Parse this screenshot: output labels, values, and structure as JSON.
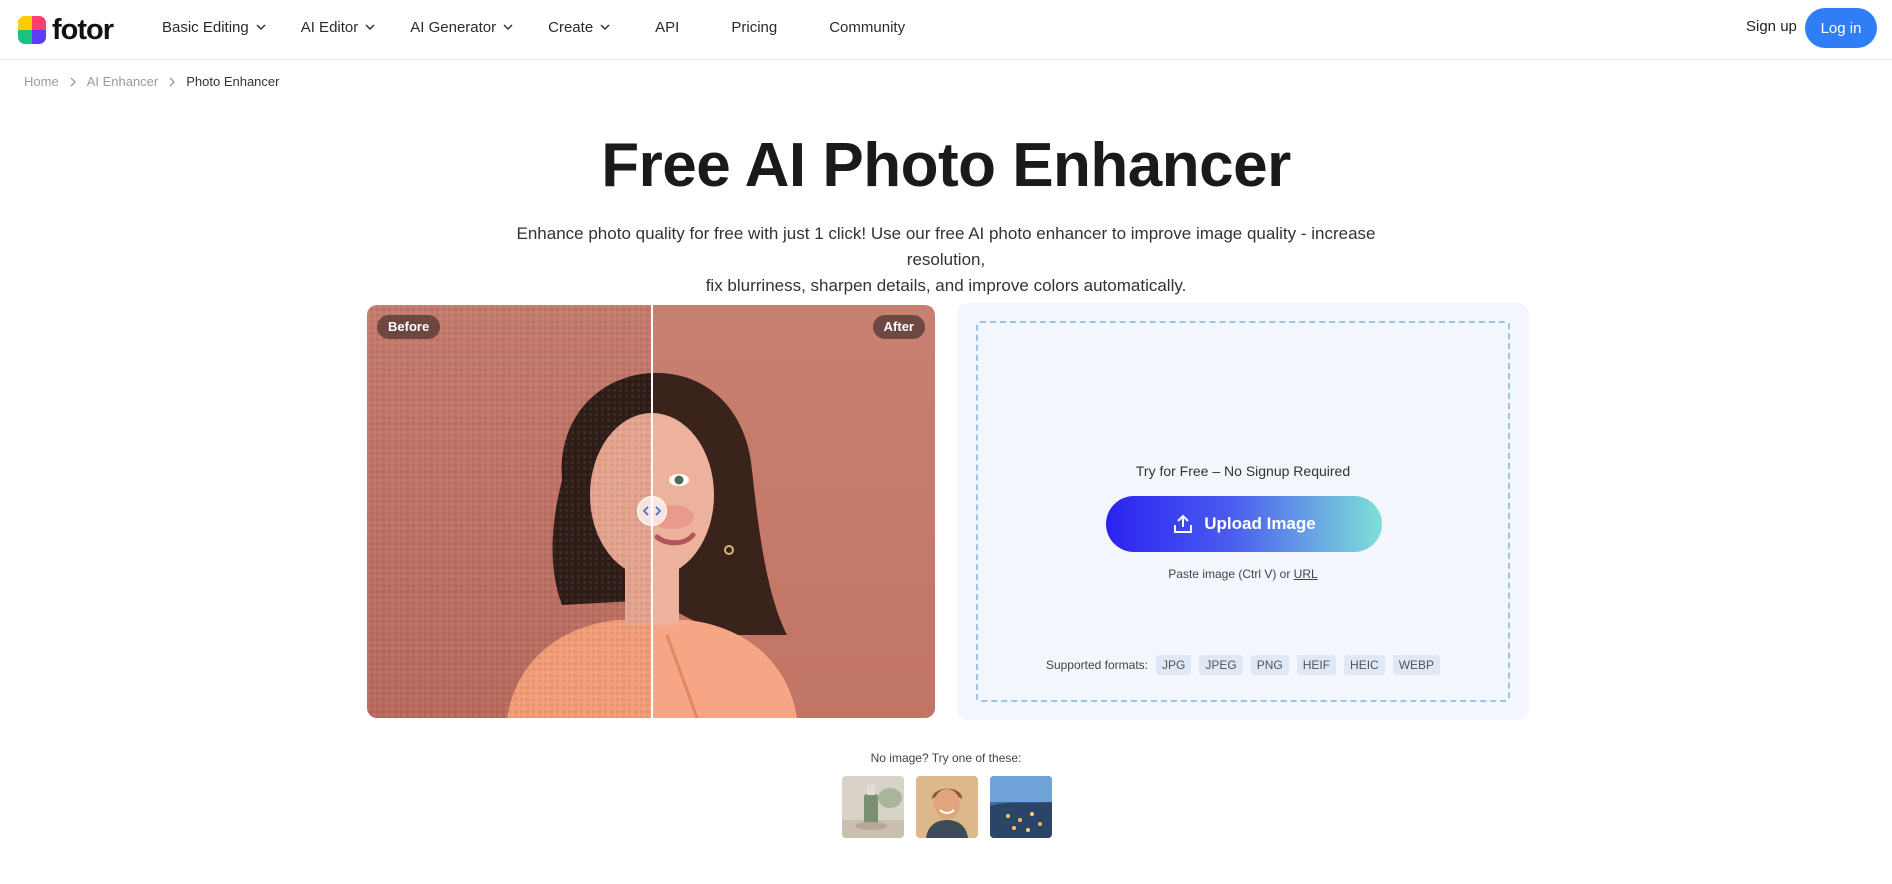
{
  "brand": {
    "name": "fotor"
  },
  "nav": {
    "items": [
      {
        "label": "Basic Editing",
        "dropdown": true
      },
      {
        "label": "AI Editor",
        "dropdown": true
      },
      {
        "label": "AI Generator",
        "dropdown": true
      },
      {
        "label": "Create",
        "dropdown": true
      },
      {
        "label": "API",
        "dropdown": false
      },
      {
        "label": "Pricing",
        "dropdown": false
      },
      {
        "label": "Community",
        "dropdown": false
      }
    ],
    "signup": "Sign up",
    "login": "Log in"
  },
  "breadcrumb": [
    "Home",
    "AI Enhancer",
    "Photo Enhancer"
  ],
  "hero": {
    "title": "Free AI Photo Enhancer",
    "subtitle_line1": "Enhance photo quality for free with just 1 click! Use our free AI photo enhancer to improve image quality - increase resolution,",
    "subtitle_line2": "fix blurriness, sharpen details, and improve colors automatically."
  },
  "compare": {
    "before_label": "Before",
    "after_label": "After",
    "slider_position": 0.5
  },
  "upload": {
    "try_free": "Try for Free – No Signup Required",
    "button_label": "Upload Image",
    "paste_text": "Paste image (Ctrl V) or ",
    "url_label": "URL",
    "formats_label": "Supported formats:",
    "formats": [
      "JPG",
      "JPEG",
      "PNG",
      "HEIF",
      "HEIC",
      "WEBP"
    ]
  },
  "samples": {
    "label": "No image? Try one of these:",
    "items": [
      "sample-product-bottle",
      "sample-man-portrait",
      "sample-coastal-city"
    ]
  },
  "colors": {
    "accent": "#2f7ef5",
    "upload_gradient_start": "#2b22f0",
    "upload_gradient_end": "#7fe0d8",
    "panel_bg": "#f3f6fd",
    "dashed_border": "#9dc3ea"
  }
}
